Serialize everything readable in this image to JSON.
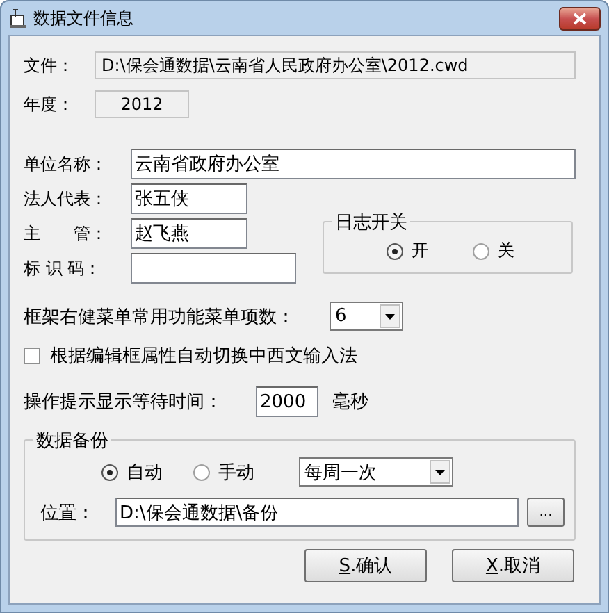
{
  "window": {
    "title": "数据文件信息"
  },
  "file": {
    "label": "文件：",
    "value": "D:\\保会通数据\\云南省人民政府办公室\\2012.cwd"
  },
  "year": {
    "label": "年度：",
    "value": "2012"
  },
  "fields": [
    {
      "label": "单位名称：",
      "value": "云南省政府办公室"
    },
    {
      "label": "法人代表：",
      "value": "张五侠"
    },
    {
      "label": "主　　管：",
      "value": "赵飞燕"
    },
    {
      "label": "标 识 码："
    }
  ],
  "log_switch": {
    "title": "日志开关",
    "options": [
      {
        "label": "开",
        "selected": true
      },
      {
        "label": "关",
        "selected": false
      }
    ]
  },
  "menu_count": {
    "label": "框架右健菜单常用功能菜单项数：",
    "value": "6"
  },
  "ime_switch": {
    "label": "根据编辑框属性自动切换中西文输入法",
    "checked": false
  },
  "tip_delay": {
    "label": "操作提示显示等待时间：",
    "value": "2000",
    "unit": "毫秒"
  },
  "backup": {
    "title": "数据备份",
    "modes": [
      {
        "label": "自动",
        "selected": true
      },
      {
        "label": "手动",
        "selected": false
      }
    ],
    "frequency": "每周一次",
    "location": {
      "label": "位置：",
      "value": "D:\\保会通数据\\备份"
    },
    "browse": "..."
  },
  "buttons": [
    {
      "label": "S.确认"
    },
    {
      "label": "X.取消"
    }
  ]
}
